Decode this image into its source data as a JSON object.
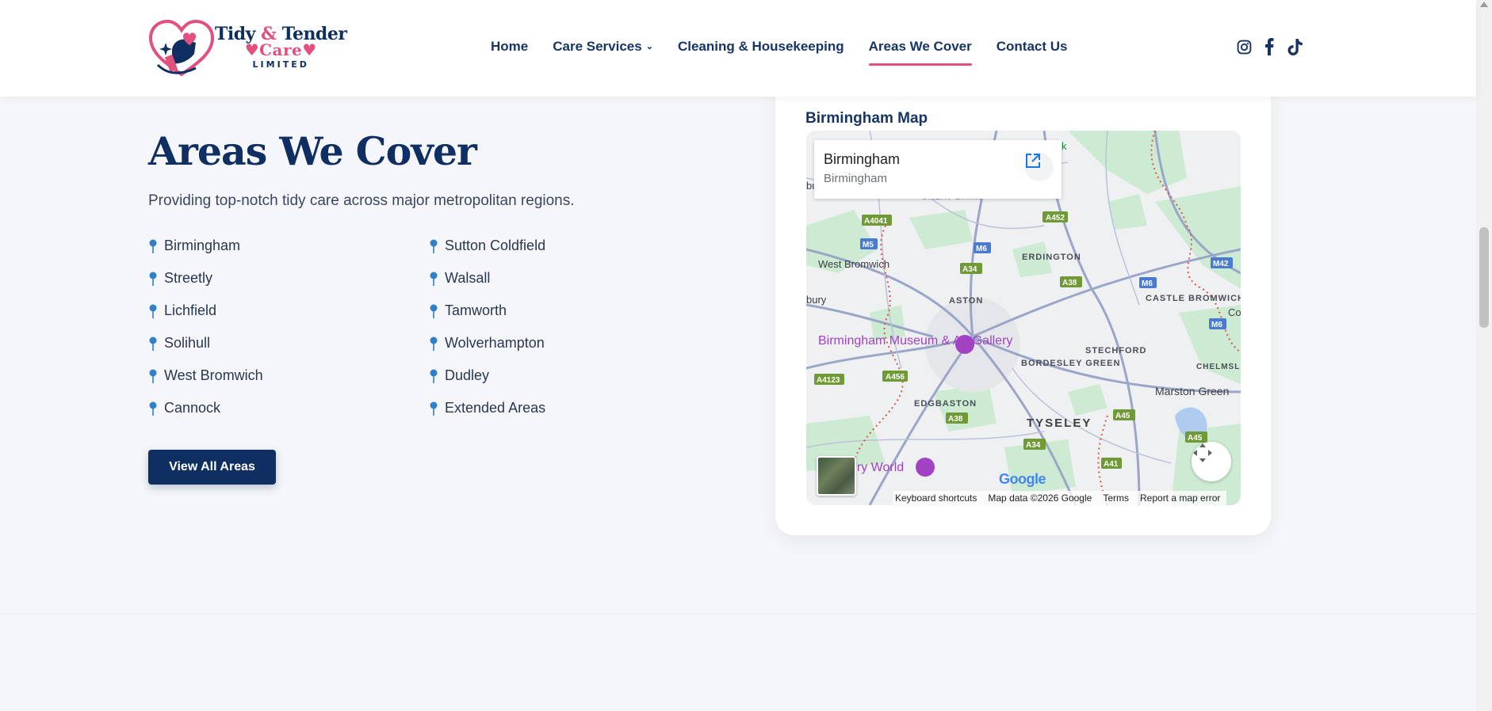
{
  "brand": {
    "line1a": "Tidy",
    "line1amp": " & ",
    "line1b": "Tender",
    "line2": "Care",
    "line3": "LIMITED"
  },
  "nav": {
    "home": "Home",
    "care_services": "Care Services",
    "cleaning": "Cleaning & Housekeeping",
    "areas": "Areas We Cover",
    "contact": "Contact Us"
  },
  "social": [
    "instagram-icon",
    "facebook-icon",
    "tiktok-icon"
  ],
  "section": {
    "title": "Areas We Cover",
    "subtitle": "Providing top-notch tidy care across major metropolitan regions.",
    "button": "View All Areas"
  },
  "areas": [
    "Birmingham",
    "Sutton Coldfield",
    "Streetly",
    "Walsall",
    "Lichfield",
    "Tamworth",
    "Solihull",
    "Wolverhampton",
    "West Bromwich",
    "Dudley",
    "Cannock",
    "Extended Areas"
  ],
  "map": {
    "label": "Birmingham Map",
    "place_name": "Birmingham",
    "place_sub": "Birmingham",
    "labels": {
      "erdington": "ERDINGTON",
      "west_bromwich": "West Bromwich",
      "aston": "ASTON",
      "castle_bromwich": "CASTLE BROMWICH",
      "museum": "Birmingham Museum & Art Gallery",
      "stechford": "STECHFORD",
      "bordesley": "BORDESLEY GREEN",
      "edgbaston": "EDGBASTON",
      "tyseley": "TYSELEY",
      "marston": "Marston Green",
      "chelmsley": "CHELMSLEY WOOD",
      "world": "ury World",
      "great_barr": "GREAT BARR",
      "bury": "bury",
      "co": "Co",
      "bu": "bu",
      "k": "k"
    },
    "roads": {
      "a4041": "A4041",
      "a452": "A452",
      "m5": "M5",
      "m6a": "M6",
      "a34a": "A34",
      "a38a": "A38",
      "m6b": "M6",
      "m42": "M42",
      "m6c": "M6",
      "a4123": "A4123",
      "a456": "A456",
      "a38b": "A38",
      "a45a": "A45",
      "a34b": "A34",
      "a45b": "A45",
      "a41": "A41"
    },
    "google": "Google",
    "attribution": {
      "shortcuts": "Keyboard shortcuts",
      "data": "Map data ©2026 Google",
      "terms": "Terms",
      "report": "Report a map error"
    }
  }
}
